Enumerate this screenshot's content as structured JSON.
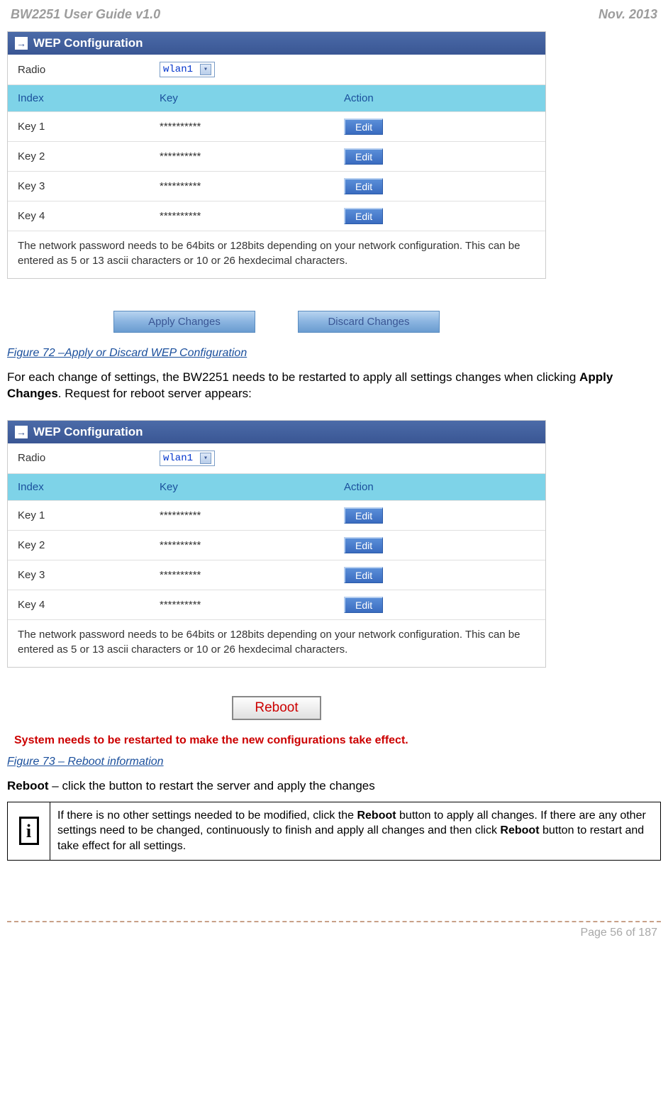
{
  "header": {
    "title": "BW2251 User Guide v1.0",
    "date": "Nov.  2013"
  },
  "panel1": {
    "title": "WEP Configuration",
    "radio_label": "Radio",
    "radio_value": "wlan1",
    "columns": {
      "index": "Index",
      "key": "Key",
      "action": "Action"
    },
    "rows": [
      {
        "index": "Key 1",
        "key": "**********",
        "action": "Edit"
      },
      {
        "index": "Key 2",
        "key": "**********",
        "action": "Edit"
      },
      {
        "index": "Key 3",
        "key": "**********",
        "action": "Edit"
      },
      {
        "index": "Key 4",
        "key": "**********",
        "action": "Edit"
      }
    ],
    "note": "The network password needs to be 64bits or 128bits depending on your network configuration. This can be entered as 5 or 13 ascii characters or 10 or 26 hexdecimal characters."
  },
  "buttons": {
    "apply": "Apply Changes",
    "discard": "Discard Changes",
    "reboot": "Reboot"
  },
  "figure72": "Figure 72 –Apply or Discard WEP Configuration",
  "body1a": "For each change of settings, the BW2251 needs to be restarted to apply all settings changes when clicking ",
  "body1b": "Apply Changes",
  "body1c": ". Request for reboot server appears:",
  "panel2": {
    "title": "WEP Configuration",
    "radio_label": "Radio",
    "radio_value": "wlan1",
    "columns": {
      "index": "Index",
      "key": "Key",
      "action": "Action"
    },
    "rows": [
      {
        "index": "Key 1",
        "key": "**********",
        "action": "Edit"
      },
      {
        "index": "Key 2",
        "key": "**********",
        "action": "Edit"
      },
      {
        "index": "Key 3",
        "key": "**********",
        "action": "Edit"
      },
      {
        "index": "Key 4",
        "key": "**********",
        "action": "Edit"
      }
    ],
    "note": "The network password needs to be 64bits or 128bits depending on your network configuration. This can be entered as 5 or 13 ascii characters or 10 or 26 hexdecimal characters."
  },
  "alert": "System needs to be restarted to make the new configurations take effect.",
  "figure73": "Figure 73 – Reboot information",
  "reboot_line_a": "Reboot",
  "reboot_line_b": " – click the button to restart the server and apply the changes",
  "info_a": "If there is no other settings needed to be modified, click the ",
  "info_b": "Reboot",
  "info_c": " button to apply all changes. If there are any other settings need to be changed, continuously to finish and apply all changes and then click ",
  "info_d": "Reboot",
  "info_e": " button to restart and take effect for all settings.",
  "footer": "Page 56 of 187"
}
